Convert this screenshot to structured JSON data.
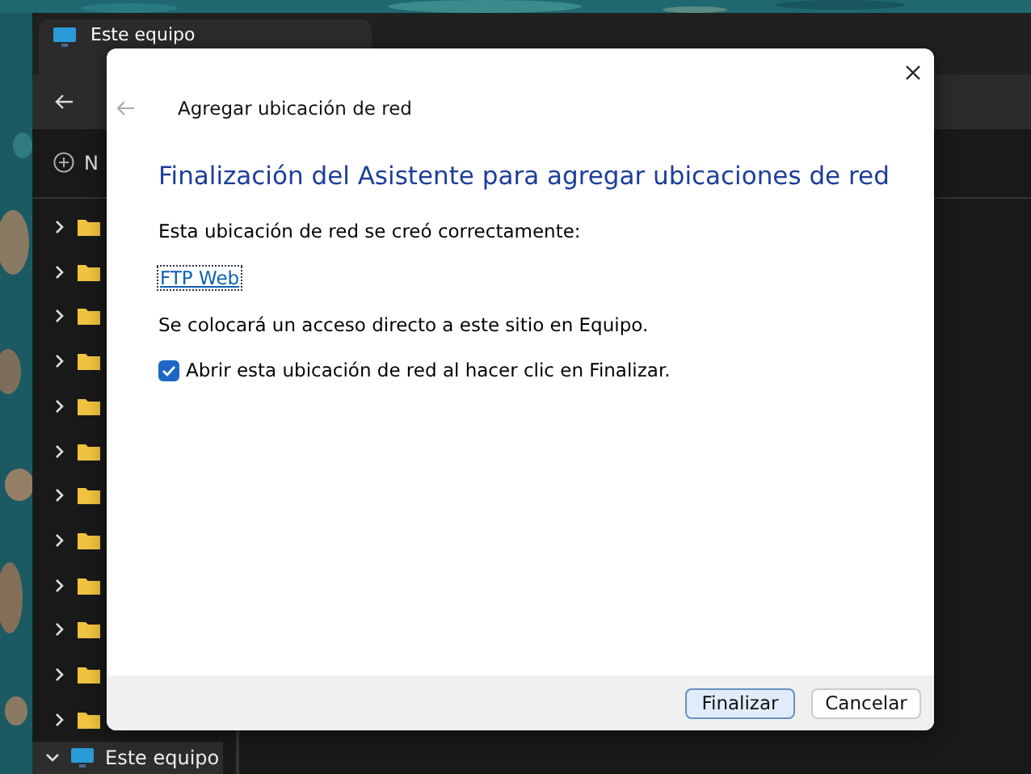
{
  "explorer": {
    "tab": {
      "title": "Este equipo"
    },
    "new_button": {
      "label": "N"
    },
    "tree": [
      {
        "expanded": false
      },
      {
        "expanded": false
      },
      {
        "expanded": false
      },
      {
        "expanded": false
      },
      {
        "expanded": false
      },
      {
        "expanded": false
      },
      {
        "expanded": false
      },
      {
        "expanded": false
      },
      {
        "expanded": false
      },
      {
        "expanded": false
      },
      {
        "expanded": false
      },
      {
        "expanded": false
      }
    ],
    "bottom_item": {
      "label": "Este equipo",
      "expanded": true
    }
  },
  "dialog": {
    "title": "Agregar ubicación de red",
    "heading": "Finalización del Asistente para agregar ubicaciones de red",
    "message": "Esta ubicación de red se creó correctamente:",
    "link": "FTP Web",
    "note": "Se colocará un acceso directo a este sitio en Equipo.",
    "option": {
      "label": "Abrir esta ubicación de red al hacer clic en Finalizar.",
      "checked": true
    },
    "buttons": [
      {
        "label": "Finalizar",
        "default": true
      },
      {
        "label": "Cancelar",
        "default": false
      }
    ]
  }
}
